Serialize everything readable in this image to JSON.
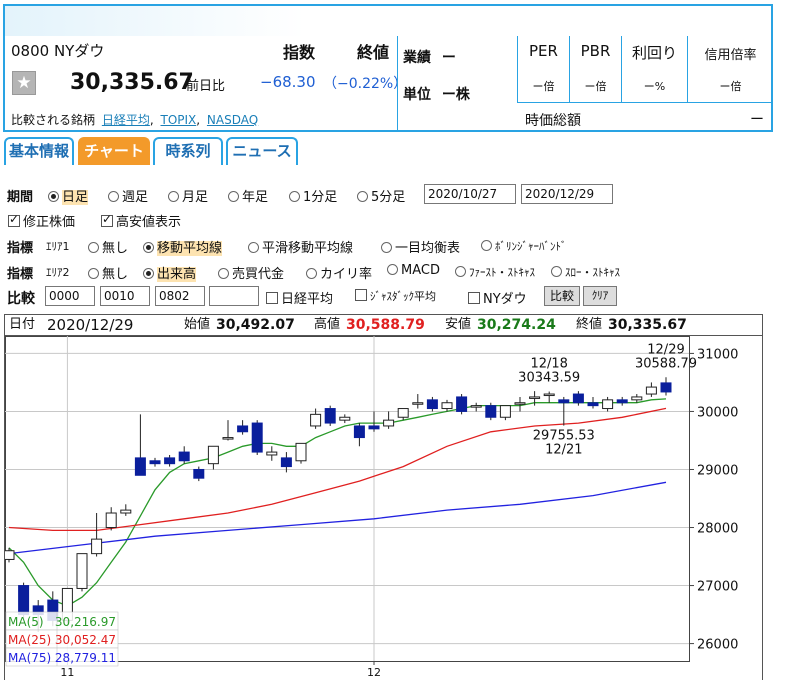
{
  "stock": {
    "code_name": "0800 NYダウ",
    "type_label": "指数",
    "close_label": "終値",
    "price": "30,335.67",
    "prev_label": "前日比",
    "change": "−68.30",
    "change_pct": "（−0.22%）",
    "compare_prefix": "比較される銘柄",
    "compare_links": [
      "日経平均",
      "TOPIX",
      "NASDAQ"
    ],
    "gyoseki_label": "業績",
    "gyoseki_value": "ー",
    "unit_label": "単位",
    "unit_value": "ー株",
    "metrics": [
      {
        "label": "PER",
        "value": "ー倍"
      },
      {
        "label": "PBR",
        "value": "ー倍"
      },
      {
        "label": "利回り",
        "value": "ー%"
      },
      {
        "label": "信用倍率",
        "value": "ー倍"
      }
    ],
    "market_cap_label": "時価総額",
    "market_cap_value": "ー"
  },
  "tabs": [
    "基本情報",
    "チャート",
    "時系列",
    "ニュース"
  ],
  "controls": {
    "period_label": "期間",
    "periods": [
      "日足",
      "週足",
      "月足",
      "年足",
      "1分足",
      "5分足"
    ],
    "date_from": "2020/10/27",
    "date_to": "2020/12/29",
    "adjusted_label": "修正株価",
    "highlow_label": "高安値表示",
    "indicator_label": "指標",
    "area1_label": "ｴﾘｱ1",
    "area1_options": [
      "無し",
      "移動平均線",
      "平滑移動平均線",
      "一目均衡表",
      "ﾎﾞﾘﾝｼﾞｬｰﾊﾞﾝﾄﾞ"
    ],
    "area2_label": "ｴﾘｱ2",
    "area2_options": [
      "無し",
      "出来高",
      "売買代金",
      "カイリ率",
      "MACD",
      "ﾌｧｰｽﾄ・ｽﾄｷｬｽ",
      "ｽﾛｰ・ｽﾄｷｬｽ"
    ],
    "compare_label": "比較",
    "compare_codes": [
      "0000",
      "0010",
      "0802",
      ""
    ],
    "compare_checks": [
      "日経平均",
      "ｼﾞｬｽﾀﾞｯｸ平均",
      "NYダウ"
    ],
    "compare_button": "比較",
    "clear_button": "ｸﾘｱ"
  },
  "ohlc_bar": {
    "date_label": "日付",
    "date": "2020/12/29",
    "open_label": "始値",
    "open": "30,492.07",
    "high_label": "高値",
    "high": "30,588.79",
    "low_label": "安値",
    "low": "30,274.24",
    "close_label": "終値",
    "close": "30,335.67"
  },
  "colors": {
    "accent": "#29a3e3",
    "tab_active": "#f39a2a",
    "up": "#ffffff",
    "down": "#0a1f9c",
    "ma5": "#2a9a2a",
    "ma25": "#e02020",
    "ma75": "#2222e0",
    "high_value": "#e02020",
    "low_value": "#1a7a1a",
    "negative": "#1f5fd3"
  },
  "chart_data": {
    "type": "candlestick",
    "y_ticks": [
      26000,
      27000,
      28000,
      29000,
      30000,
      31000
    ],
    "ylim": [
      25700,
      31300
    ],
    "x_tick_labels": [
      {
        "label": "11",
        "index": 4
      },
      {
        "label": "12",
        "index": 25
      }
    ],
    "annotations": [
      {
        "lines": [
          "12/18",
          "30343.59"
        ],
        "index": 37,
        "value": 30343.59,
        "pos": "above"
      },
      {
        "lines": [
          "12/29",
          "30588.79"
        ],
        "index": 45,
        "value": 30588.79,
        "pos": "above"
      },
      {
        "lines": [
          "29755.53",
          "12/21"
        ],
        "index": 38,
        "value": 29755.53,
        "pos": "below"
      }
    ],
    "candles": [
      {
        "o": 27450,
        "h": 27650,
        "c": 27600,
        "l": 27400
      },
      {
        "o": 27000,
        "h": 27050,
        "c": 26500,
        "l": 26400
      },
      {
        "o": 26650,
        "h": 26750,
        "c": 26500,
        "l": 26200
      },
      {
        "o": 26750,
        "h": 26900,
        "c": 26400,
        "l": 26300
      },
      {
        "o": 26400,
        "h": 26950,
        "c": 26950,
        "l": 26350
      },
      {
        "o": 26950,
        "h": 27550,
        "c": 27550,
        "l": 26900
      },
      {
        "o": 27550,
        "h": 28250,
        "c": 27800,
        "l": 27500
      },
      {
        "o": 28000,
        "h": 28350,
        "c": 28250,
        "l": 27950
      },
      {
        "o": 28250,
        "h": 28400,
        "c": 28300,
        "l": 28200
      },
      {
        "o": 29200,
        "h": 29950,
        "c": 28900,
        "l": 28900
      },
      {
        "o": 29150,
        "h": 29200,
        "c": 29100,
        "l": 29050
      },
      {
        "o": 29200,
        "h": 29250,
        "c": 29100,
        "l": 29050
      },
      {
        "o": 29300,
        "h": 29400,
        "c": 29150,
        "l": 29100
      },
      {
        "o": 29000,
        "h": 29050,
        "c": 28850,
        "l": 28800
      },
      {
        "o": 29100,
        "h": 29400,
        "c": 29400,
        "l": 29000
      },
      {
        "o": 29550,
        "h": 29850,
        "c": 29550,
        "l": 29500
      },
      {
        "o": 29750,
        "h": 29850,
        "c": 29650,
        "l": 29600
      },
      {
        "o": 29800,
        "h": 29850,
        "c": 29300,
        "l": 29250
      },
      {
        "o": 29250,
        "h": 29400,
        "c": 29300,
        "l": 29150
      },
      {
        "o": 29200,
        "h": 29300,
        "c": 29050,
        "l": 28950
      },
      {
        "o": 29150,
        "h": 29450,
        "c": 29450,
        "l": 29100
      },
      {
        "o": 29750,
        "h": 30050,
        "c": 29950,
        "l": 29700
      },
      {
        "o": 30050,
        "h": 30100,
        "c": 29800,
        "l": 29750
      },
      {
        "o": 29850,
        "h": 29950,
        "c": 29900,
        "l": 29800
      },
      {
        "o": 29750,
        "h": 29800,
        "c": 29550,
        "l": 29400
      },
      {
        "o": 29750,
        "h": 30000,
        "c": 29700,
        "l": 29650
      },
      {
        "o": 29750,
        "h": 30000,
        "c": 29850,
        "l": 29700
      },
      {
        "o": 29900,
        "h": 30050,
        "c": 30050,
        "l": 29850
      },
      {
        "o": 30150,
        "h": 30300,
        "c": 30150,
        "l": 30050
      },
      {
        "o": 30200,
        "h": 30250,
        "c": 30050,
        "l": 30000
      },
      {
        "o": 30050,
        "h": 30200,
        "c": 30150,
        "l": 30000
      },
      {
        "o": 30250,
        "h": 30300,
        "c": 30000,
        "l": 29950
      },
      {
        "o": 30100,
        "h": 30150,
        "c": 30100,
        "l": 30000
      },
      {
        "o": 30100,
        "h": 30150,
        "c": 29900,
        "l": 29850
      },
      {
        "o": 29900,
        "h": 30100,
        "c": 30100,
        "l": 29850
      },
      {
        "o": 30150,
        "h": 30250,
        "c": 30150,
        "l": 30000
      },
      {
        "o": 30250,
        "h": 30350,
        "c": 30250,
        "l": 30100
      },
      {
        "o": 30300,
        "h": 30343,
        "c": 30300,
        "l": 30150
      },
      {
        "o": 30200,
        "h": 30250,
        "c": 30150,
        "l": 29756
      },
      {
        "o": 30300,
        "h": 30350,
        "c": 30150,
        "l": 30100
      },
      {
        "o": 30150,
        "h": 30250,
        "c": 30100,
        "l": 30050
      },
      {
        "o": 30050,
        "h": 30250,
        "c": 30200,
        "l": 30000
      },
      {
        "o": 30200,
        "h": 30250,
        "c": 30150,
        "l": 30100
      },
      {
        "o": 30200,
        "h": 30300,
        "c": 30250,
        "l": 30150
      },
      {
        "o": 30300,
        "h": 30500,
        "c": 30420,
        "l": 30250
      },
      {
        "o": 30492,
        "h": 30589,
        "c": 30336,
        "l": 30274
      }
    ],
    "series": [
      {
        "name": "MA(5)",
        "value": "30,216.97",
        "points": [
          [
            0,
            27650
          ],
          [
            1,
            27400
          ],
          [
            2,
            27000
          ],
          [
            3,
            26750
          ],
          [
            4,
            26650
          ],
          [
            5,
            26800
          ],
          [
            6,
            27050
          ],
          [
            7,
            27400
          ],
          [
            8,
            27750
          ],
          [
            9,
            28200
          ],
          [
            10,
            28650
          ],
          [
            11,
            28950
          ],
          [
            12,
            29100
          ],
          [
            13,
            29150
          ],
          [
            14,
            29200
          ],
          [
            15,
            29300
          ],
          [
            16,
            29400
          ],
          [
            17,
            29450
          ],
          [
            18,
            29450
          ],
          [
            19,
            29400
          ],
          [
            20,
            29400
          ],
          [
            21,
            29550
          ],
          [
            22,
            29650
          ],
          [
            23,
            29750
          ],
          [
            24,
            29800
          ],
          [
            25,
            29800
          ],
          [
            26,
            29800
          ],
          [
            27,
            29850
          ],
          [
            28,
            29900
          ],
          [
            29,
            29950
          ],
          [
            30,
            30000
          ],
          [
            31,
            30050
          ],
          [
            32,
            30100
          ],
          [
            33,
            30100
          ],
          [
            34,
            30100
          ],
          [
            35,
            30100
          ],
          [
            36,
            30150
          ],
          [
            37,
            30150
          ],
          [
            38,
            30150
          ],
          [
            39,
            30150
          ],
          [
            40,
            30150
          ],
          [
            41,
            30150
          ],
          [
            42,
            30150
          ],
          [
            43,
            30150
          ],
          [
            44,
            30200
          ],
          [
            45,
            30217
          ]
        ]
      },
      {
        "name": "MA(25)",
        "value": "30,052.47",
        "points": [
          [
            0,
            28000
          ],
          [
            3,
            27950
          ],
          [
            6,
            27950
          ],
          [
            9,
            28050
          ],
          [
            12,
            28150
          ],
          [
            15,
            28250
          ],
          [
            18,
            28400
          ],
          [
            21,
            28600
          ],
          [
            24,
            28800
          ],
          [
            27,
            29050
          ],
          [
            30,
            29400
          ],
          [
            33,
            29650
          ],
          [
            36,
            29750
          ],
          [
            39,
            29800
          ],
          [
            42,
            29900
          ],
          [
            45,
            30052
          ]
        ]
      },
      {
        "name": "MA(75)",
        "value": "28,779.11",
        "points": [
          [
            0,
            27550
          ],
          [
            5,
            27700
          ],
          [
            10,
            27850
          ],
          [
            15,
            27950
          ],
          [
            20,
            28050
          ],
          [
            25,
            28150
          ],
          [
            30,
            28300
          ],
          [
            35,
            28400
          ],
          [
            40,
            28550
          ],
          [
            45,
            28779
          ]
        ]
      }
    ]
  }
}
